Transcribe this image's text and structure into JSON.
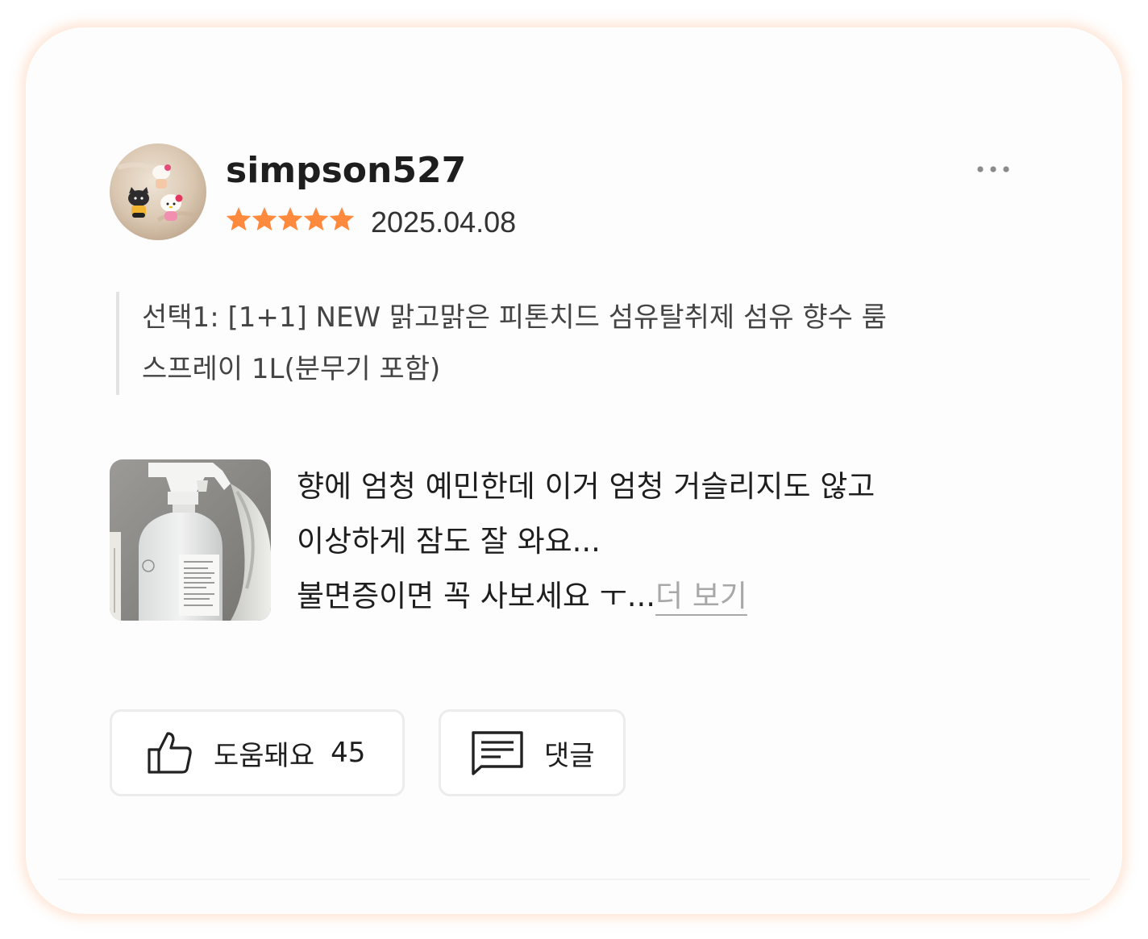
{
  "review": {
    "username": "simpson527",
    "date": "2025.04.08",
    "rating": 5,
    "rating_max": 5,
    "option_line1": "선택1: [1+1] NEW 맑고맑은 피톤치드 섬유탈취제 섬유 향수 룸",
    "option_line2": "스프레이 1L(분무기 포함)",
    "body_line1": "향에 엄청 예민한데 이거 엄청 거슬리지도 않고",
    "body_line2": "이상하게 잠도 잘 와요...",
    "body_line3": "불면증이면 꼭 사보세요 ㅜ",
    "ellipsis": "...",
    "more_label": "더 보기"
  },
  "actions": {
    "helpful_label": "도움돼요",
    "helpful_count": "45",
    "comment_label": "댓글"
  },
  "icons": {
    "more": "more-dots-icon",
    "helpful": "thumbs-up-icon",
    "comment": "comment-icon",
    "star": "star-icon"
  },
  "colors": {
    "star": "#FF8A3D",
    "card_glow": "#FFD3B8",
    "more_link": "#A8A8A8"
  }
}
